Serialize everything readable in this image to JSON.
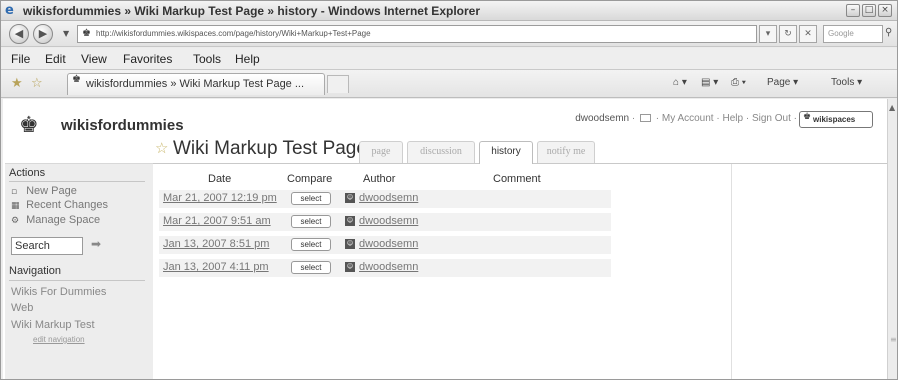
{
  "window": {
    "title": "wikisfordummies » Wiki Markup Test Page » history - Windows Internet Explorer"
  },
  "address": {
    "url": "http://wikisfordummies.wikispaces.com/page/history/Wiki+Markup+Test+Page",
    "search_placeholder": "Google"
  },
  "menu": [
    "File",
    "Edit",
    "View",
    "Favorites",
    "Tools",
    "Help"
  ],
  "toolbar": {
    "tab_label": "wikisfordummies » Wiki Markup Test Page ...",
    "page_label": "Page ▾",
    "tools_label": "Tools ▾"
  },
  "site": {
    "name": "wikisfordummies",
    "user": "dwoodsemn",
    "my_account": "My Account",
    "help": "Help",
    "sign_out": "Sign Out",
    "brand": "wikispaces"
  },
  "sidebar": {
    "actions_heading": "Actions",
    "actions": [
      {
        "label": "New Page",
        "icon": "new-page-icon"
      },
      {
        "label": "Recent Changes",
        "icon": "recent-changes-icon"
      },
      {
        "label": "Manage Space",
        "icon": "manage-space-icon"
      }
    ],
    "search_value": "Search",
    "navigation_heading": "Navigation",
    "nav_items": [
      "Wikis For Dummies",
      "Web",
      "Wiki Markup Test"
    ],
    "edit_navigation": "edit navigation"
  },
  "page": {
    "title": "Wiki Markup Test Page",
    "tabs": [
      "page",
      "discussion",
      "history",
      "notify me"
    ],
    "active_tab": "history"
  },
  "history": {
    "headers": [
      "Date",
      "Compare",
      "Author",
      "Comment"
    ],
    "rows": [
      {
        "date": "Mar 21, 2007 12:19 pm",
        "select": "select",
        "author": "dwoodsemn"
      },
      {
        "date": "Mar 21, 2007 9:51 am",
        "select": "select",
        "author": "dwoodsemn"
      },
      {
        "date": "Jan 13, 2007 8:51 pm",
        "select": "select",
        "author": "dwoodsemn"
      },
      {
        "date": "Jan 13, 2007 4:11 pm",
        "select": "select",
        "author": "dwoodsemn"
      }
    ]
  }
}
